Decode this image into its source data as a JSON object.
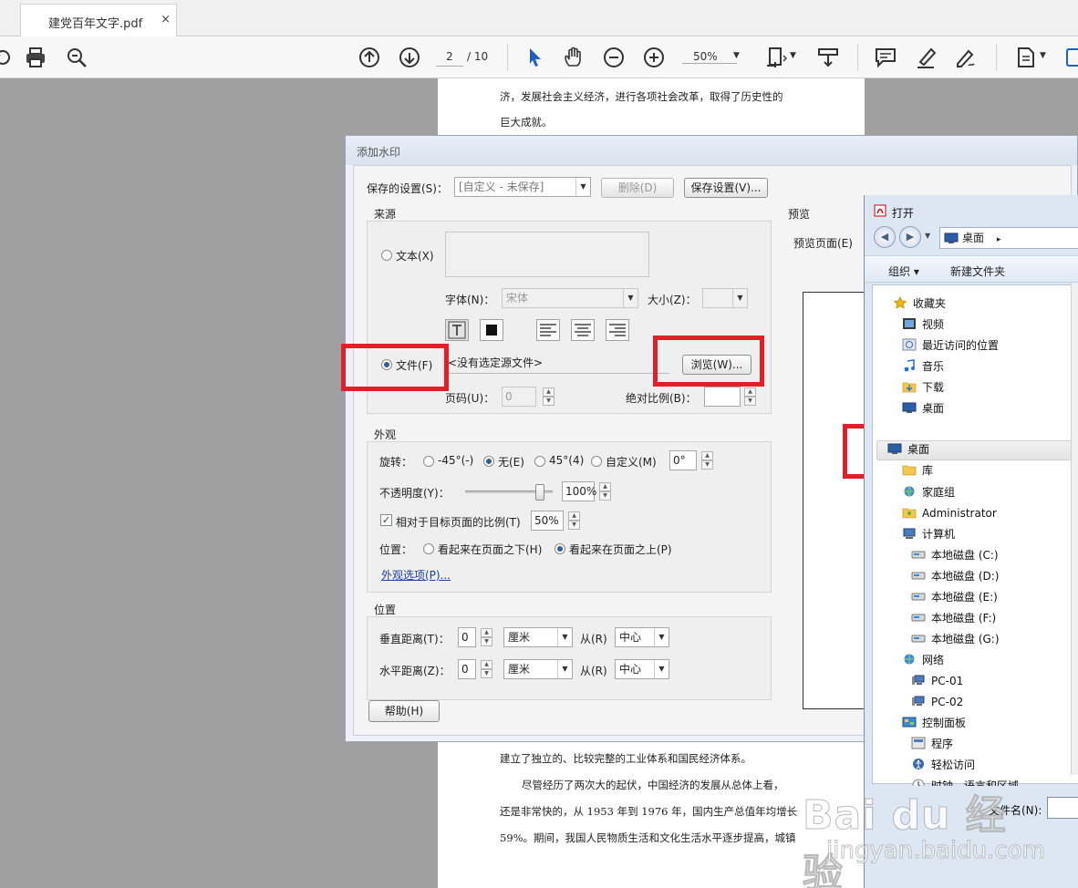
{
  "tab": {
    "title": "建党百年文字.pdf",
    "close": "×"
  },
  "toolbar": {
    "page_current": "2",
    "page_total": "/ 10",
    "zoom": "50%"
  },
  "document": {
    "lines_top": [
      "济，发展社会主义经济，进行各项社会改革，取得了历史性的",
      "巨大成就。"
    ],
    "lines_bottom": [
      "建立了独立的、比较完整的工业体系和国民经济体系。",
      "尽管经历了两次大的起伏，中国经济的发展从总体上看，",
      "还是非常快的，从 1953 年到 1976 年，国内生产总值年均增长",
      "59%。期间，我国人民物质生活和文化生活水平逐步提高，城镇"
    ]
  },
  "watermark_dialog": {
    "title": "添加水印",
    "saved_settings_label": "保存的设置(S)：",
    "saved_settings_value": "[自定义 - 未保存]",
    "delete_button": "删除(D)",
    "save_settings_button": "保存设置(V)...",
    "source": {
      "group_label": "来源",
      "text_radio": "文本(X)",
      "font_label": "字体(N)：",
      "font_value": "宋体",
      "size_label": "大小(Z)：",
      "file_radio": "文件(F)",
      "file_value": "<没有选定源文件>",
      "browse_button": "浏览(W)...",
      "page_label": "页码(U)：",
      "page_value": "0",
      "abs_scale_label": "绝对比例(B)："
    },
    "appearance": {
      "group_label": "外观",
      "rotation_label": "旋转：",
      "rot_minus45": "-45°(-)",
      "rot_none": "无(E)",
      "rot_45": "45°(4)",
      "rot_custom": "自定义(M)",
      "rot_custom_value": "0°",
      "opacity_label": "不透明度(Y)：",
      "opacity_value": "100%",
      "opacity_level": 0.9,
      "relative_scale_label": "相对于目标页面的比例(T)",
      "relative_scale_value": "50%",
      "position_label": "位置：",
      "behind_page": "看起来在页面之下(H)",
      "on_top_page": "看起来在页面之上(P)",
      "appearance_options_link": "外观选项(P)..."
    },
    "position": {
      "group_label": "位置",
      "vertical_label": "垂直距离(T)：",
      "vertical_value": "0",
      "vertical_unit": "厘米",
      "vertical_from_label": "从(R)",
      "vertical_from": "中心",
      "horizontal_label": "水平距离(Z)：",
      "horizontal_value": "0",
      "horizontal_unit": "厘米",
      "horizontal_from_label": "从(R)",
      "horizontal_from": "中心"
    },
    "preview": {
      "group_label": "预览",
      "preview_page_label": "预览页面(E)"
    },
    "help_button": "帮助(H)"
  },
  "open_dialog": {
    "title": "打开",
    "address": "桌面",
    "address_arrow": "▸",
    "organize": "组织 ▾",
    "new_folder": "新建文件夹",
    "tree": [
      {
        "label": "收藏夹",
        "indent": 0,
        "icon": "star-icon"
      },
      {
        "label": "视频",
        "indent": 1,
        "icon": "video-folder-icon"
      },
      {
        "label": "最近访问的位置",
        "indent": 1,
        "icon": "recent-places-icon"
      },
      {
        "label": "音乐",
        "indent": 1,
        "icon": "music-icon"
      },
      {
        "label": "下载",
        "indent": 1,
        "icon": "download-folder-icon"
      },
      {
        "label": "桌面",
        "indent": 1,
        "icon": "desktop-icon"
      },
      {
        "label": "桌面",
        "indent": 0,
        "icon": "desktop-icon",
        "selected": true
      },
      {
        "label": "库",
        "indent": 1,
        "icon": "library-icon"
      },
      {
        "label": "家庭组",
        "indent": 1,
        "icon": "homegroup-icon"
      },
      {
        "label": "Administrator",
        "indent": 1,
        "icon": "user-folder-icon"
      },
      {
        "label": "计算机",
        "indent": 1,
        "icon": "computer-icon"
      },
      {
        "label": "本地磁盘 (C:)",
        "indent": 2,
        "icon": "disk-icon"
      },
      {
        "label": "本地磁盘 (D:)",
        "indent": 2,
        "icon": "disk-icon"
      },
      {
        "label": "本地磁盘 (E:)",
        "indent": 2,
        "icon": "disk-icon"
      },
      {
        "label": "本地磁盘 (F:)",
        "indent": 2,
        "icon": "disk-icon"
      },
      {
        "label": "本地磁盘 (G:)",
        "indent": 2,
        "icon": "disk-icon"
      },
      {
        "label": "网络",
        "indent": 1,
        "icon": "network-icon"
      },
      {
        "label": "PC-01",
        "indent": 2,
        "icon": "pc-icon"
      },
      {
        "label": "PC-02",
        "indent": 2,
        "icon": "pc-icon"
      },
      {
        "label": "控制面板",
        "indent": 1,
        "icon": "control-panel-icon"
      },
      {
        "label": "程序",
        "indent": 2,
        "icon": "programs-icon"
      },
      {
        "label": "轻松访问",
        "indent": 2,
        "icon": "ease-access-icon"
      },
      {
        "label": "时钟、语言和区域",
        "indent": 2,
        "icon": "clock-icon"
      }
    ],
    "filename_label": "文件名(N):"
  },
  "watermark_overlay": {
    "brand": "Bai du 经验",
    "url": "jingyan.baidu.com"
  },
  "colors": {
    "highlight_red": "#e01f26",
    "accent_blue": "#1f5fbf"
  }
}
